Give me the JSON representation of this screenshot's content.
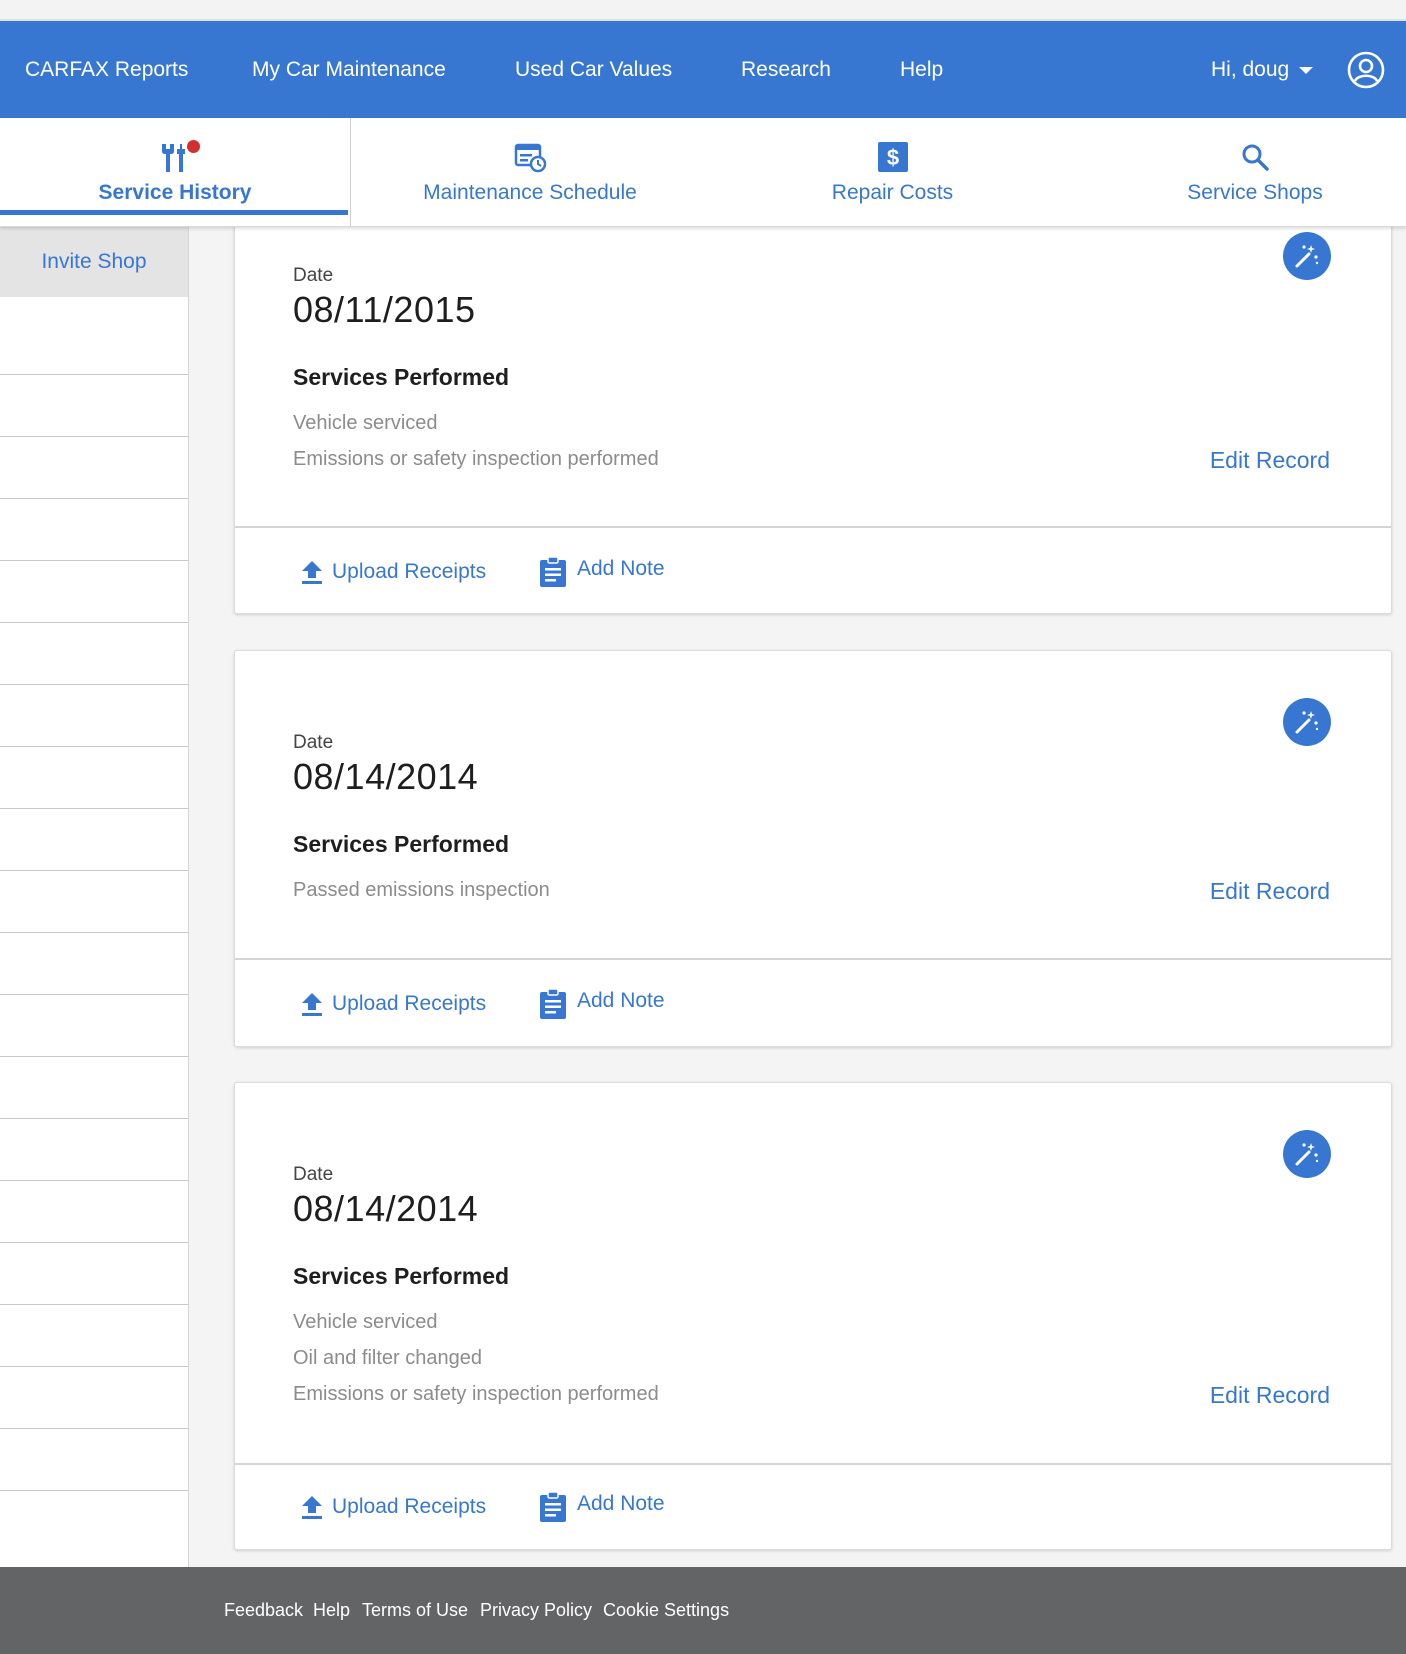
{
  "nav": {
    "items": [
      "CARFAX Reports",
      "My Car Maintenance",
      "Used Car Values",
      "Research",
      "Help"
    ],
    "greeting": "Hi, doug",
    "color": "#3777d1"
  },
  "tabs": [
    {
      "label": "Service History",
      "icon": "wrench-screwdriver-icon",
      "active": true
    },
    {
      "label": "Maintenance Schedule",
      "icon": "calendar-clock-icon",
      "active": false
    },
    {
      "label": "Repair Costs",
      "icon": "dollar-icon",
      "active": false
    },
    {
      "label": "Service Shops",
      "icon": "search-icon",
      "active": false
    }
  ],
  "sidebar": {
    "invite_label": "Invite Shop"
  },
  "records": [
    {
      "date_label": "Date",
      "date": "08/11/2015",
      "services_title": "Services Performed",
      "services": [
        "Vehicle serviced",
        "Emissions or safety inspection performed"
      ],
      "edit_label": "Edit Record",
      "upload_label": "Upload Receipts",
      "note_label": "Add Note"
    },
    {
      "date_label": "Date",
      "date": "08/14/2014",
      "services_title": "Services Performed",
      "services": [
        "Passed emissions inspection"
      ],
      "edit_label": "Edit Record",
      "upload_label": "Upload Receipts",
      "note_label": "Add Note"
    },
    {
      "date_label": "Date",
      "date": "08/14/2014",
      "services_title": "Services Performed",
      "services": [
        "Vehicle serviced",
        "Oil and filter changed",
        "Emissions or safety inspection performed"
      ],
      "edit_label": "Edit Record",
      "upload_label": "Upload Receipts",
      "note_label": "Add Note"
    }
  ],
  "footer": {
    "links": [
      "Feedback",
      "Help",
      "Terms of Use",
      "Privacy Policy",
      "Cookie Settings"
    ]
  }
}
